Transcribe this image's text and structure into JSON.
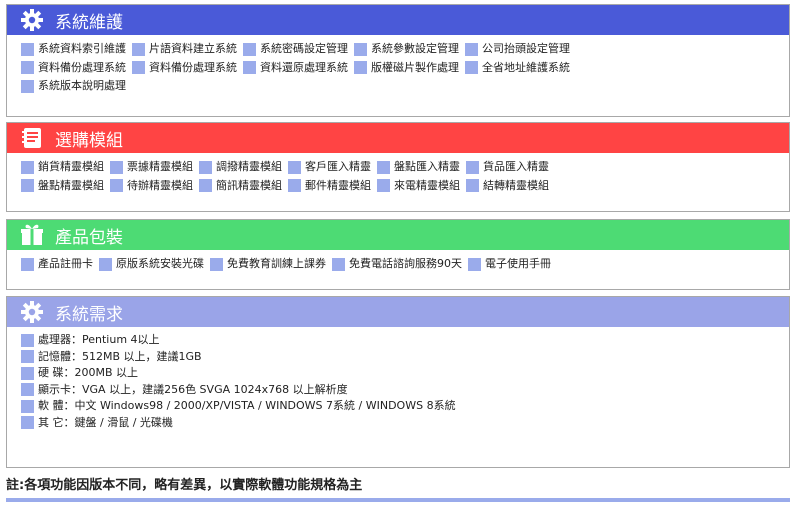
{
  "sections": {
    "system_maintenance": {
      "title": "系統維護",
      "color": "#4a5ad8",
      "rows": [
        [
          "系統資料索引維護",
          "片語資料建立系統",
          "系統密碼設定管理",
          "系統參數設定管理",
          "公司抬頭設定管理"
        ],
        [
          "資料備份處理系統",
          "資料備份處理系統",
          "資料還原處理系統",
          "版權磁片製作處理",
          "全省地址維護系統"
        ],
        [
          "系統版本說明處理"
        ]
      ]
    },
    "optional_modules": {
      "title": "選購模組",
      "color": "#ff4444",
      "rows": [
        [
          "銷貨精靈模組",
          "票據精靈模組",
          "調撥精靈模組",
          "客戶匯入精靈",
          "盤點匯入精靈",
          "貨品匯入精靈"
        ],
        [
          "盤點精靈模組",
          "待辦精靈模組",
          "簡訊精靈模組",
          "郵件精靈模組",
          "來電精靈模組",
          "結轉精靈模組"
        ]
      ]
    },
    "product_package": {
      "title": "產品包裝",
      "color": "#4ddb74",
      "rows": [
        [
          "產品註冊卡",
          "原版系統安裝光碟",
          "免費教育訓練上課券",
          "免費電話諮詢服務90天",
          "電子使用手冊"
        ]
      ]
    },
    "system_requirements": {
      "title": "系統需求",
      "color": "#9aa4e8",
      "items": [
        "處理器：Pentium 4以上",
        "記憶體：512MB 以上，建議1GB",
        "硬 碟：200MB 以上",
        "顯示卡：VGA 以上，建議256色 SVGA 1024x768 以上解析度",
        "軟 體：中文 Windows98 / 2000/XP/VISTA / WINDOWS 7系統 / WINDOWS 8系統",
        "其 它：鍵盤 / 滑鼠 / 光碟機"
      ]
    }
  },
  "note": "註:各項功能因版本不同，略有差異，以實際軟體功能規格為主",
  "icons": {
    "system_maintenance": "gear-icon",
    "optional_modules": "notebook-icon",
    "product_package": "gift-icon",
    "system_requirements": "gear-icon"
  }
}
